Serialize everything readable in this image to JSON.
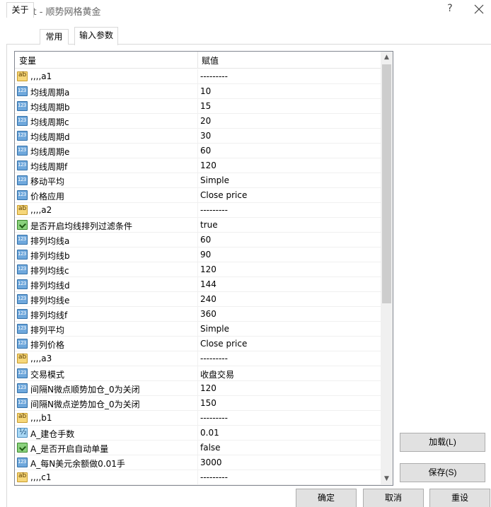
{
  "window": {
    "title": "Expert - 顺势网格黄金",
    "help_label": "?"
  },
  "tabs": [
    {
      "label": "关于"
    },
    {
      "label": "常用"
    },
    {
      "label": "输入参数"
    }
  ],
  "grid": {
    "col_variable": "变量",
    "col_value": "赋值",
    "rows": [
      {
        "icon": "ab",
        "name": ",,,,a1",
        "value": "---------"
      },
      {
        "icon": "n123",
        "name": "均线周期a",
        "value": "10"
      },
      {
        "icon": "n123",
        "name": "均线周期b",
        "value": "15"
      },
      {
        "icon": "n123",
        "name": "均线周期c",
        "value": "20"
      },
      {
        "icon": "n123",
        "name": "均线周期d",
        "value": "30"
      },
      {
        "icon": "n123",
        "name": "均线周期e",
        "value": "60"
      },
      {
        "icon": "n123",
        "name": "均线周期f",
        "value": "120"
      },
      {
        "icon": "n123",
        "name": "移动平均",
        "value": "Simple"
      },
      {
        "icon": "n123",
        "name": "价格应用",
        "value": "Close price"
      },
      {
        "icon": "ab",
        "name": ",,,,a2",
        "value": "---------"
      },
      {
        "icon": "bool",
        "name": "是否开启均线排列过滤条件",
        "value": "true"
      },
      {
        "icon": "n123",
        "name": "排列均线a",
        "value": "60"
      },
      {
        "icon": "n123",
        "name": "排列均线b",
        "value": "90"
      },
      {
        "icon": "n123",
        "name": "排列均线c",
        "value": "120"
      },
      {
        "icon": "n123",
        "name": "排列均线d",
        "value": "144"
      },
      {
        "icon": "n123",
        "name": "排列均线e",
        "value": "240"
      },
      {
        "icon": "n123",
        "name": "排列均线f",
        "value": "360"
      },
      {
        "icon": "n123",
        "name": "排列平均",
        "value": "Simple"
      },
      {
        "icon": "n123",
        "name": "排列价格",
        "value": "Close price"
      },
      {
        "icon": "ab",
        "name": ",,,,a3",
        "value": "---------"
      },
      {
        "icon": "n123",
        "name": "交易模式",
        "value": "收盘交易"
      },
      {
        "icon": "n123",
        "name": "间隔N微点顺势加仓_0为关闭",
        "value": "120"
      },
      {
        "icon": "n123",
        "name": "间隔N微点逆势加仓_0为关闭",
        "value": "150"
      },
      {
        "icon": "ab",
        "name": ",,,,b1",
        "value": "---------"
      },
      {
        "icon": "half",
        "name": "A_建仓手数",
        "value": "0.01"
      },
      {
        "icon": "bool",
        "name": "A_是否开启自动单量",
        "value": "false"
      },
      {
        "icon": "n123",
        "name": "A_每N美元余额做0.01手",
        "value": "3000"
      },
      {
        "icon": "ab",
        "name": ",,,,c1",
        "value": "---------"
      }
    ]
  },
  "buttons": {
    "load": "加载(L)",
    "save": "保存(S)",
    "ok": "确定",
    "cancel": "取消",
    "reset": "重设"
  }
}
